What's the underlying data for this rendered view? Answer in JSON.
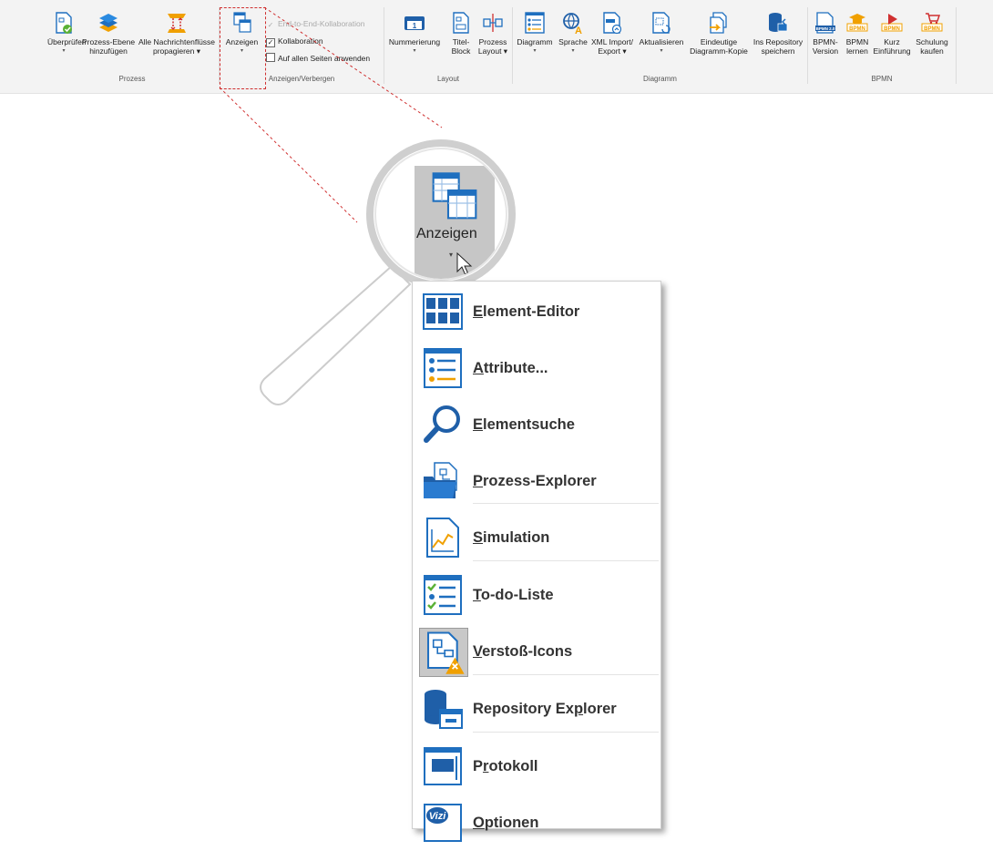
{
  "ribbon": {
    "groups": {
      "prozess": "Prozess",
      "anzeigen_verbergen": "Anzeigen/Verbergen",
      "layout": "Layout",
      "diagramm": "Diagramm",
      "bpmn": "BPMN"
    },
    "buttons": {
      "ueberpruefen": [
        "Überprüfen",
        ""
      ],
      "prozess_ebene": [
        "Prozess-Ebene",
        "hinzufügen"
      ],
      "nachrichtenfluesse": [
        "Alle Nachrichtenflüsse",
        "propagieren ▾"
      ],
      "anzeigen": [
        "Anzeigen",
        ""
      ],
      "nummerierung": [
        "Nummerierung",
        ""
      ],
      "titelblock": [
        "Titel-",
        "Block"
      ],
      "prozess_layout": [
        "Prozess",
        "Layout ▾"
      ],
      "diagramm": [
        "Diagramm",
        ""
      ],
      "sprache": [
        "Sprache",
        ""
      ],
      "xml": [
        "XML Import/",
        "Export ▾"
      ],
      "aktualisieren": [
        "Aktualisieren",
        ""
      ],
      "eindeutige": [
        "Eindeutige",
        "Diagramm-Kopie"
      ],
      "repository": [
        "Ins Repository",
        "speichern"
      ],
      "bpmn_version": [
        "BPMN-",
        "Version"
      ],
      "bpmn_lernen": [
        "BPMN",
        "lernen"
      ],
      "kurz": [
        "Kurz",
        "Einführung"
      ],
      "schulung": [
        "Schulung",
        "kaufen"
      ]
    },
    "checkboxes": {
      "e2e": "End-to-End-Kollaboration",
      "kollaboration": "Kollaboration",
      "alle_seiten": "Auf allen Seiten anwenden"
    },
    "badges": {
      "nummer": "1",
      "bpmn20": "BPMN 2.0",
      "bpmn": "BPMN",
      "vizi": "Vizi"
    }
  },
  "magnifier": {
    "label": "Anzeigen",
    "arrow": "▾"
  },
  "menu": {
    "items": [
      {
        "pre": "",
        "ul": "E",
        "post": "lement-Editor",
        "icon": "grid-icon"
      },
      {
        "pre": "",
        "ul": "A",
        "post": "ttribute...",
        "icon": "attribute-list-icon"
      },
      {
        "pre": "",
        "ul": "E",
        "post": "lementsuche",
        "icon": "magnifier-icon"
      },
      {
        "pre": "",
        "ul": "P",
        "post": "rozess-Explorer",
        "icon": "folder-process-icon"
      },
      {
        "pre": "",
        "ul": "S",
        "post": "imulation",
        "icon": "simulation-chart-icon"
      },
      {
        "pre": "",
        "ul": "T",
        "post": "o-do-Liste",
        "icon": "todo-list-icon"
      },
      {
        "pre": "",
        "ul": "V",
        "post": "erstoß-Icons",
        "icon": "violation-icon"
      },
      {
        "pre": "Repository Ex",
        "ul": "p",
        "post": "lorer",
        "icon": "repository-icon"
      },
      {
        "pre": "P",
        "ul": "r",
        "post": "otokoll",
        "icon": "protocol-icon"
      },
      {
        "pre": "",
        "ul": "O",
        "post": "ptionen",
        "icon": "vizi-options-icon"
      }
    ]
  },
  "colors": {
    "accent_blue": "#1f6fbf",
    "check_green": "#5ab135",
    "bpmn_orange": "#f0a000",
    "highlight_red": "#d03030"
  }
}
